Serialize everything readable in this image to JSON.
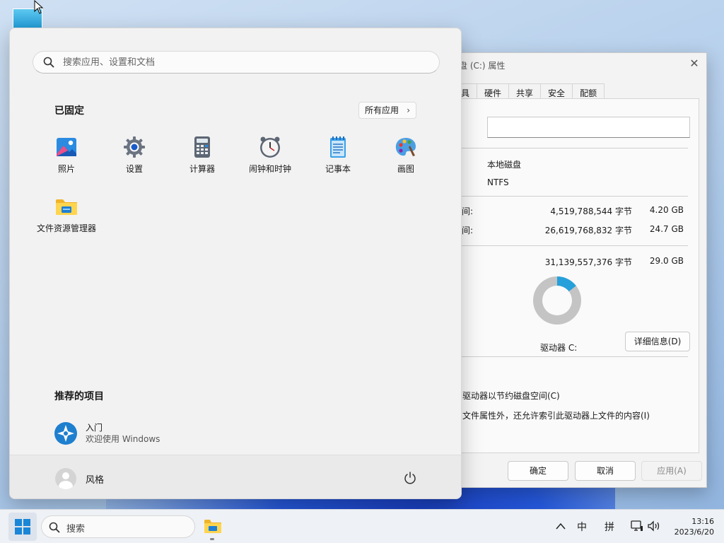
{
  "properties_window": {
    "title": "盘 (C:) 属性",
    "tabs": [
      "具",
      "硬件",
      "共享",
      "安全",
      "配额"
    ],
    "name_field_value": "",
    "type_value": "本地磁盘",
    "filesystem_value": "NTFS",
    "used_label": "空间:",
    "used_bytes": "4,519,788,544 字节",
    "used_size": "4.20 GB",
    "free_label": "空间:",
    "free_bytes": "26,619,768,832 字节",
    "free_size": "24.7 GB",
    "capacity_label": ":",
    "capacity_bytes": "31,139,557,376 字节",
    "capacity_size": "29.0 GB",
    "used_fraction": 0.145,
    "drive_label": "驱动器 C:",
    "details_button": "详细信息(D)",
    "compress_option": "驱动器以节约磁盘空间(C)",
    "index_option": "文件属性外，还允许索引此驱动器上文件的内容(I)",
    "ok_button": "确定",
    "cancel_button": "取消",
    "apply_button": "应用(A)"
  },
  "start_menu": {
    "search_placeholder": "搜索应用、设置和文档",
    "pinned_title": "已固定",
    "all_apps_label": "所有应用",
    "pinned_apps": [
      {
        "label": "照片",
        "icon": "photos-icon"
      },
      {
        "label": "设置",
        "icon": "settings-gear-icon"
      },
      {
        "label": "计算器",
        "icon": "calculator-icon"
      },
      {
        "label": "闹钟和时钟",
        "icon": "clock-icon"
      },
      {
        "label": "记事本",
        "icon": "notepad-icon"
      },
      {
        "label": "画图",
        "icon": "paint-icon"
      },
      {
        "label": "文件资源管理器",
        "icon": "folder-icon"
      }
    ],
    "recommended_title": "推荐的项目",
    "recommended": [
      {
        "title": "入门",
        "subtitle": "欢迎使用 Windows"
      }
    ],
    "user_name": "风格"
  },
  "taskbar": {
    "search_label": "搜索",
    "ime_mode": "中",
    "ime_name": "拼",
    "time": "13:16",
    "date": "2023/6/20"
  },
  "colors": {
    "accent": "#1a86d8",
    "donut_used": "#26a0da",
    "donut_free": "#c4c4c4"
  }
}
